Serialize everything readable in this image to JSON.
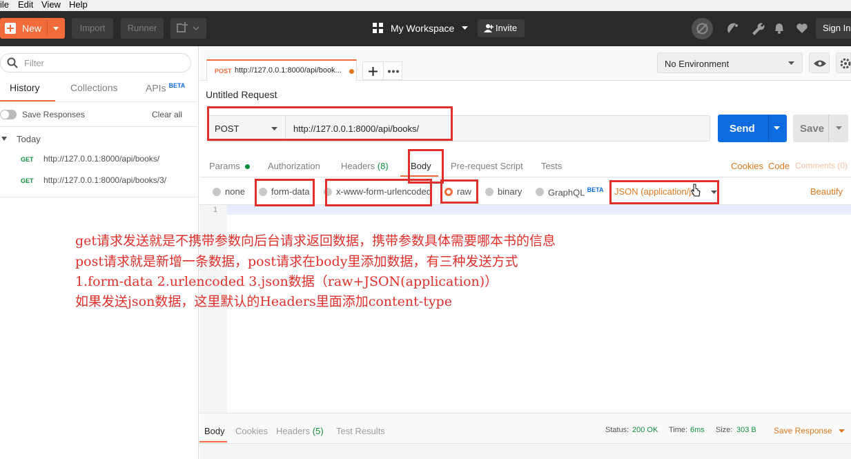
{
  "menubar": {
    "file": "ile",
    "edit": "Edit",
    "view": "View",
    "help": "Help"
  },
  "header": {
    "new": "New",
    "import": "Import",
    "runner": "Runner",
    "workspace": "My Workspace",
    "invite": "Invite",
    "signin": "Sign In",
    "accent": "#f26b3a"
  },
  "sidebar": {
    "filter_placeholder": "Filter",
    "tabs": {
      "history": "History",
      "collections": "Collections",
      "apis": "APIs",
      "apis_badge": "BETA"
    },
    "save_responses": "Save Responses",
    "clear_all": "Clear all",
    "group": "Today",
    "items": [
      {
        "method": "GET",
        "url": "http://127.0.0.1:8000/api/books/"
      },
      {
        "method": "GET",
        "url": "http://127.0.0.1:8000/api/books/3/"
      }
    ]
  },
  "tab": {
    "method": "POST",
    "url": "http://127.0.0.1:8000/api/book..."
  },
  "environment": {
    "selected": "No Environment"
  },
  "request": {
    "title": "Untitled Request",
    "method": "POST",
    "url": "http://127.0.0.1:8000/api/books/",
    "send": "Send",
    "save": "Save"
  },
  "request_tabs": {
    "params": "Params",
    "authorization": "Authorization",
    "headers": "Headers",
    "headers_count": "(8)",
    "body": "Body",
    "prerequest": "Pre-request Script",
    "tests": "Tests",
    "cookies": "Cookies",
    "code": "Code",
    "comments": "Comments (0)"
  },
  "body_modes": {
    "none": "none",
    "form_data": "form-data",
    "urlencoded": "x-www-form-urlencoded",
    "raw": "raw",
    "binary": "binary",
    "graphql": "GraphQL",
    "graphql_badge": "BETA",
    "content_type": "JSON (application/js",
    "beautify": "Beautify",
    "selected": "raw"
  },
  "editor": {
    "line_number": "1"
  },
  "annotation": {
    "line1": "get请求发送就是不携带参数向后台请求返回数据，携带参数具体需要哪本书的信息",
    "line2": "post请求就是新增一条数据，post请求在body里添加数据，有三种发送方式",
    "line3": "1.form-data  2.urlencoded 3.json数据（raw+JSON(application)）",
    "line4": "如果发送json数据，这里默认的Headers里面添加content-type"
  },
  "response": {
    "tabs": {
      "body": "Body",
      "cookies": "Cookies",
      "headers": "Headers",
      "headers_count": "(5)",
      "test_results": "Test Results"
    },
    "status_label": "Status:",
    "status": "200 OK",
    "time_label": "Time:",
    "time": "6ms",
    "size_label": "Size:",
    "size": "303 B",
    "save_response": "Save Response"
  }
}
